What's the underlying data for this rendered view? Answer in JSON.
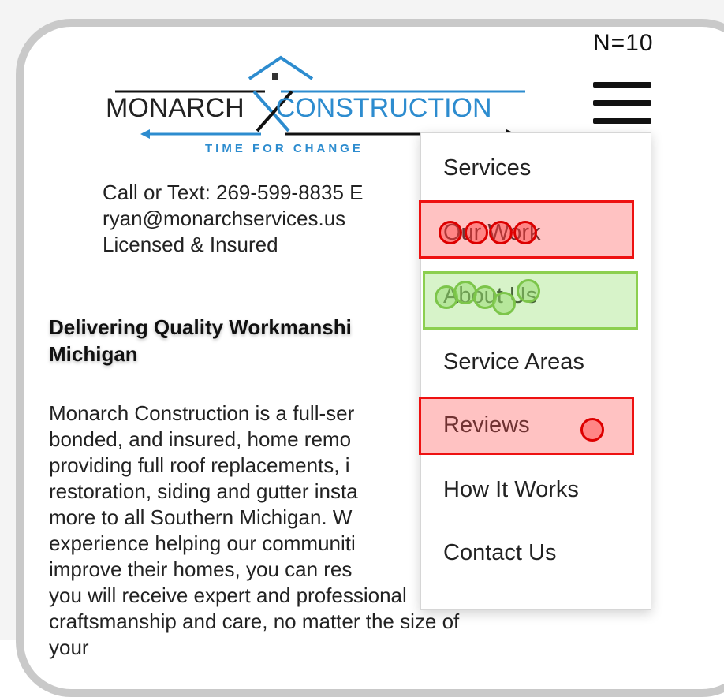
{
  "header": {
    "n_label": "N=10",
    "logo_left": "MONARCH",
    "logo_right": "CONSTRUCTION",
    "logo_tagline": "TIME FOR CHANGE"
  },
  "contact": {
    "phone": "Call or Text: 269-599-8835  E",
    "email": "ryan@monarchservices.us",
    "licensed": "Licensed & Insured"
  },
  "headline": "Delivering Quality Workmanshi\nMichigan",
  "body_text": "Monarch Construction is a full-ser\nbonded, and insured, home remo\nproviding full roof replacements, i\nrestoration, siding and gutter insta\nmore to all Southern Michigan. W\nexperience helping our communiti\nimprove their homes, you can res\nyou will receive expert and professional\ncraftsmanship and care, no matter the size of your",
  "menu": {
    "items": [
      {
        "label": "Services"
      },
      {
        "label": "Our Work"
      },
      {
        "label": "About Us"
      },
      {
        "label": "Service Areas"
      },
      {
        "label": "Reviews"
      },
      {
        "label": "How It Works"
      },
      {
        "label": "Contact Us"
      }
    ]
  },
  "colors": {
    "brand_blue": "#2d8ccf",
    "highlight_red": "#ee1111",
    "highlight_green": "#8ccf4f"
  },
  "icons": [
    "hamburger-menu-icon",
    "house-roof-logo-icon"
  ]
}
